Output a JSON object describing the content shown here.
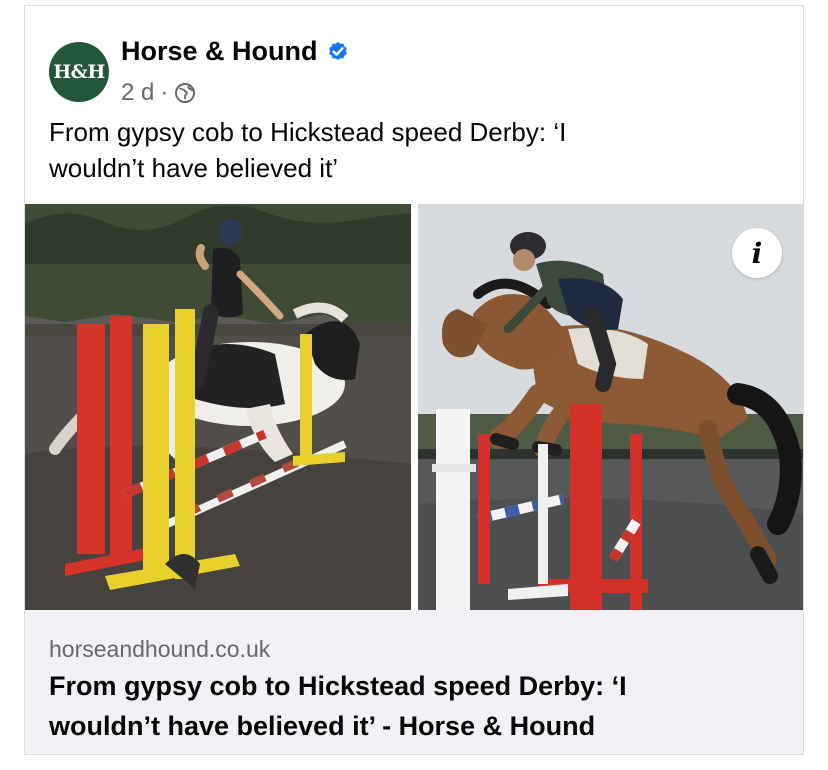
{
  "post": {
    "page_name": "Horse & Hound",
    "avatar_text": "H&H",
    "time": "2 d",
    "dot": "·",
    "caption_line1": "From gypsy cob to Hickstead speed Derby: ‘I",
    "caption_line2": "wouldn’t have believed it’"
  },
  "media": {
    "info_label": "i"
  },
  "link": {
    "domain": "horseandhound.co.uk",
    "title_line1": "From gypsy cob to Hickstead speed Derby: ‘I",
    "title_line2": "wouldn’t have believed it’ - Horse & Hound"
  },
  "colors": {
    "avatar_bg": "#24573a",
    "verified": "#1877f2",
    "secondary_text": "#65676b",
    "link_bg": "#f0f2f5"
  },
  "icons": {
    "verified": "verified-badge-icon",
    "audience": "globe-icon",
    "info": "info-icon"
  }
}
